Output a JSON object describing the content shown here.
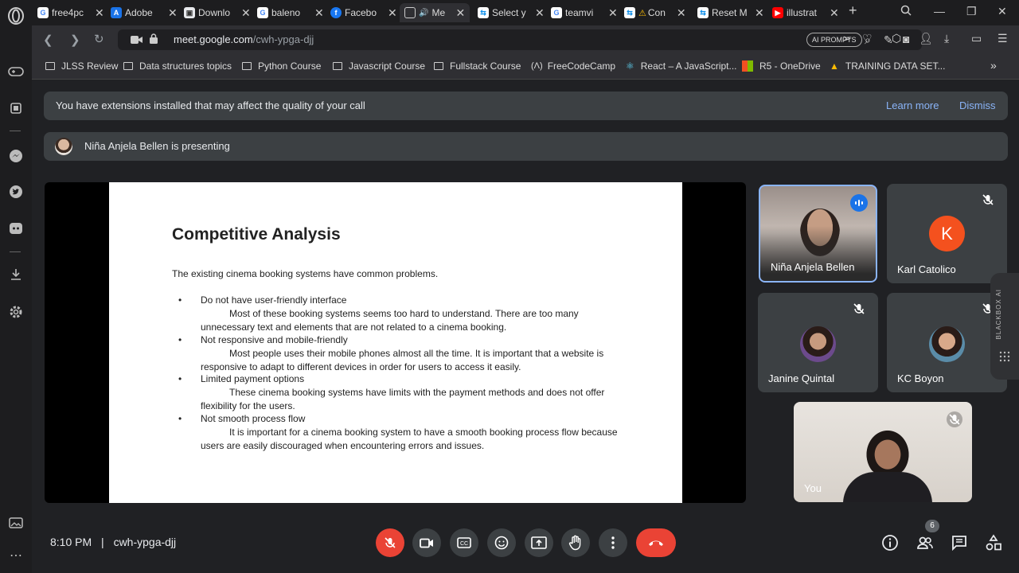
{
  "browser": {
    "tabs": [
      {
        "label": "free4pc",
        "icon": "google-icon",
        "color": "#4285f4"
      },
      {
        "label": "Adobe",
        "icon": "adobe-doc-icon",
        "color": "#1a73e8"
      },
      {
        "label": "Downlo",
        "icon": "download-page-icon",
        "color": "#5f6368"
      },
      {
        "label": "baleno",
        "icon": "google-icon",
        "color": "#4285f4"
      },
      {
        "label": "Facebo",
        "icon": "facebook-icon",
        "color": "#1877f2"
      },
      {
        "label": "Me",
        "icon": "meet-icon",
        "color": "#00832d"
      },
      {
        "label": "Select y",
        "icon": "teamviewer-icon",
        "color": "#0e8ee9"
      },
      {
        "label": "teamvi",
        "icon": "google-icon",
        "color": "#4285f4"
      },
      {
        "label": "Con",
        "icon": "warning-icon",
        "color": "#fbbc04"
      },
      {
        "label": "Reset M",
        "icon": "teamviewer-icon",
        "color": "#0e8ee9"
      },
      {
        "label": "illustrat",
        "icon": "youtube-icon",
        "color": "#ff0000"
      }
    ],
    "url_domain": "meet.google.com",
    "url_path": "/cwh-ypga-djj",
    "ai_prompts": "AI PROMPTS",
    "bookmarks": [
      "JLSS Review",
      "Data structures topics",
      "Python Course",
      "Javascript Course",
      "Fullstack Course",
      "FreeCodeCamp",
      "React – A JavaScript...",
      "R5 - OneDrive",
      "TRAINING DATA SET..."
    ]
  },
  "meet": {
    "extension_banner": {
      "text": "You have extensions installed that may affect the quality of your call",
      "learn_more": "Learn more",
      "dismiss": "Dismiss"
    },
    "presenting_text": "Niña Anjela Bellen is presenting",
    "slide": {
      "title": "Competitive Analysis",
      "intro": "The existing cinema booking systems have common problems.",
      "items": [
        {
          "heading": "Do not have user-friendly interface",
          "detail": "Most of these booking systems seems too hard to understand. There are too many unnecessary text and elements that are not related to a cinema booking."
        },
        {
          "heading": "Not responsive and mobile-friendly",
          "detail": "Most people uses their mobile phones almost all the time. It is important that a website is responsive to adapt to different devices in order for users to access it easily."
        },
        {
          "heading": "Limited payment options",
          "detail": "These cinema booking systems have limits with the payment methods and does not offer flexibility for the users."
        },
        {
          "heading": "Not smooth process flow",
          "detail": "It is important for a cinema booking system to have a smooth booking process flow because users are easily discouraged when encountering errors and issues."
        }
      ]
    },
    "participants": {
      "p1": "Niña Anjela Bellen",
      "p2": "Karl Catolico",
      "p2_initial": "K",
      "p3": "Janine Quintal",
      "p4": "KC Boyon",
      "self": "You"
    },
    "time": "8:10 PM",
    "separator": "|",
    "meeting_code": "cwh-ypga-djj",
    "people_count": "6",
    "blackbox": "BLACKBOX AI"
  }
}
